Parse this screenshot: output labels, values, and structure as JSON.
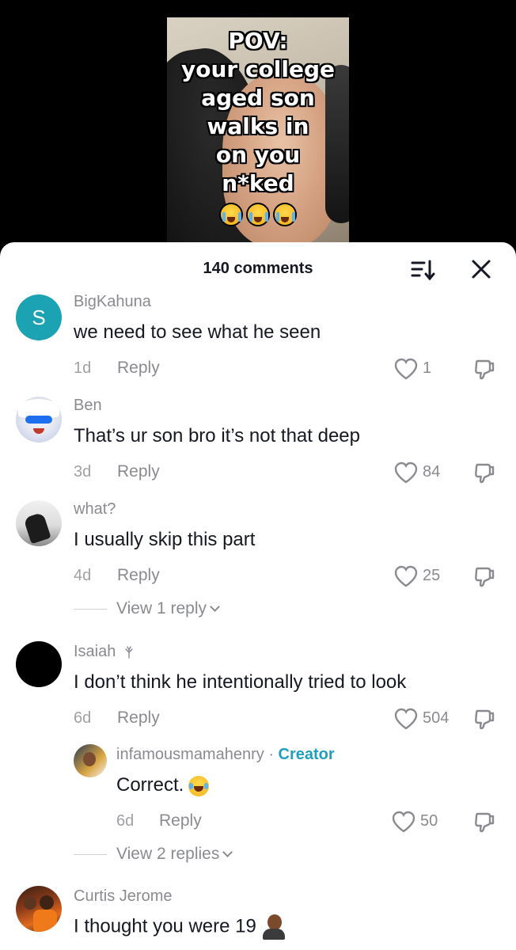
{
  "video": {
    "overlay_lines": [
      "POV:",
      "your college",
      "aged son",
      "walks in",
      "on you",
      "n*ked"
    ],
    "overlay_emoji": "😭😭😭"
  },
  "sheet": {
    "comment_count": "140 comments",
    "sort_icon": "sort-icon",
    "close_icon": "close-icon"
  },
  "colors": {
    "creator_accent": "#1f9fbd",
    "avatar_s_bg": "#1ba3b3",
    "text_primary": "#161823",
    "text_secondary": "#8a8b91"
  },
  "comments": [
    {
      "avatar_letter": "S",
      "username": "BigKahuna",
      "text": "we need to see what he seen",
      "age": "1d",
      "reply_label": "Reply",
      "likes": "1"
    },
    {
      "username": "Ben",
      "text": "That’s ur son bro it’s not that deep",
      "age": "3d",
      "reply_label": "Reply",
      "likes": "84"
    },
    {
      "username": "what?",
      "text": "I usually skip this part",
      "age": "4d",
      "reply_label": "Reply",
      "likes": "25",
      "view_replies": "View 1 reply"
    },
    {
      "username": "Isaiah",
      "text": "I don’t think he intentionally tried to look",
      "age": "6d",
      "reply_label": "Reply",
      "likes": "504",
      "reply": {
        "username": "infamousmamahenry",
        "separator": "·",
        "badge": "Creator",
        "text": "Correct.",
        "age": "6d",
        "reply_label": "Reply",
        "likes": "50"
      },
      "view_replies": "View 2 replies"
    },
    {
      "username": "Curtis Jerome",
      "text": "I thought you were 19"
    }
  ]
}
